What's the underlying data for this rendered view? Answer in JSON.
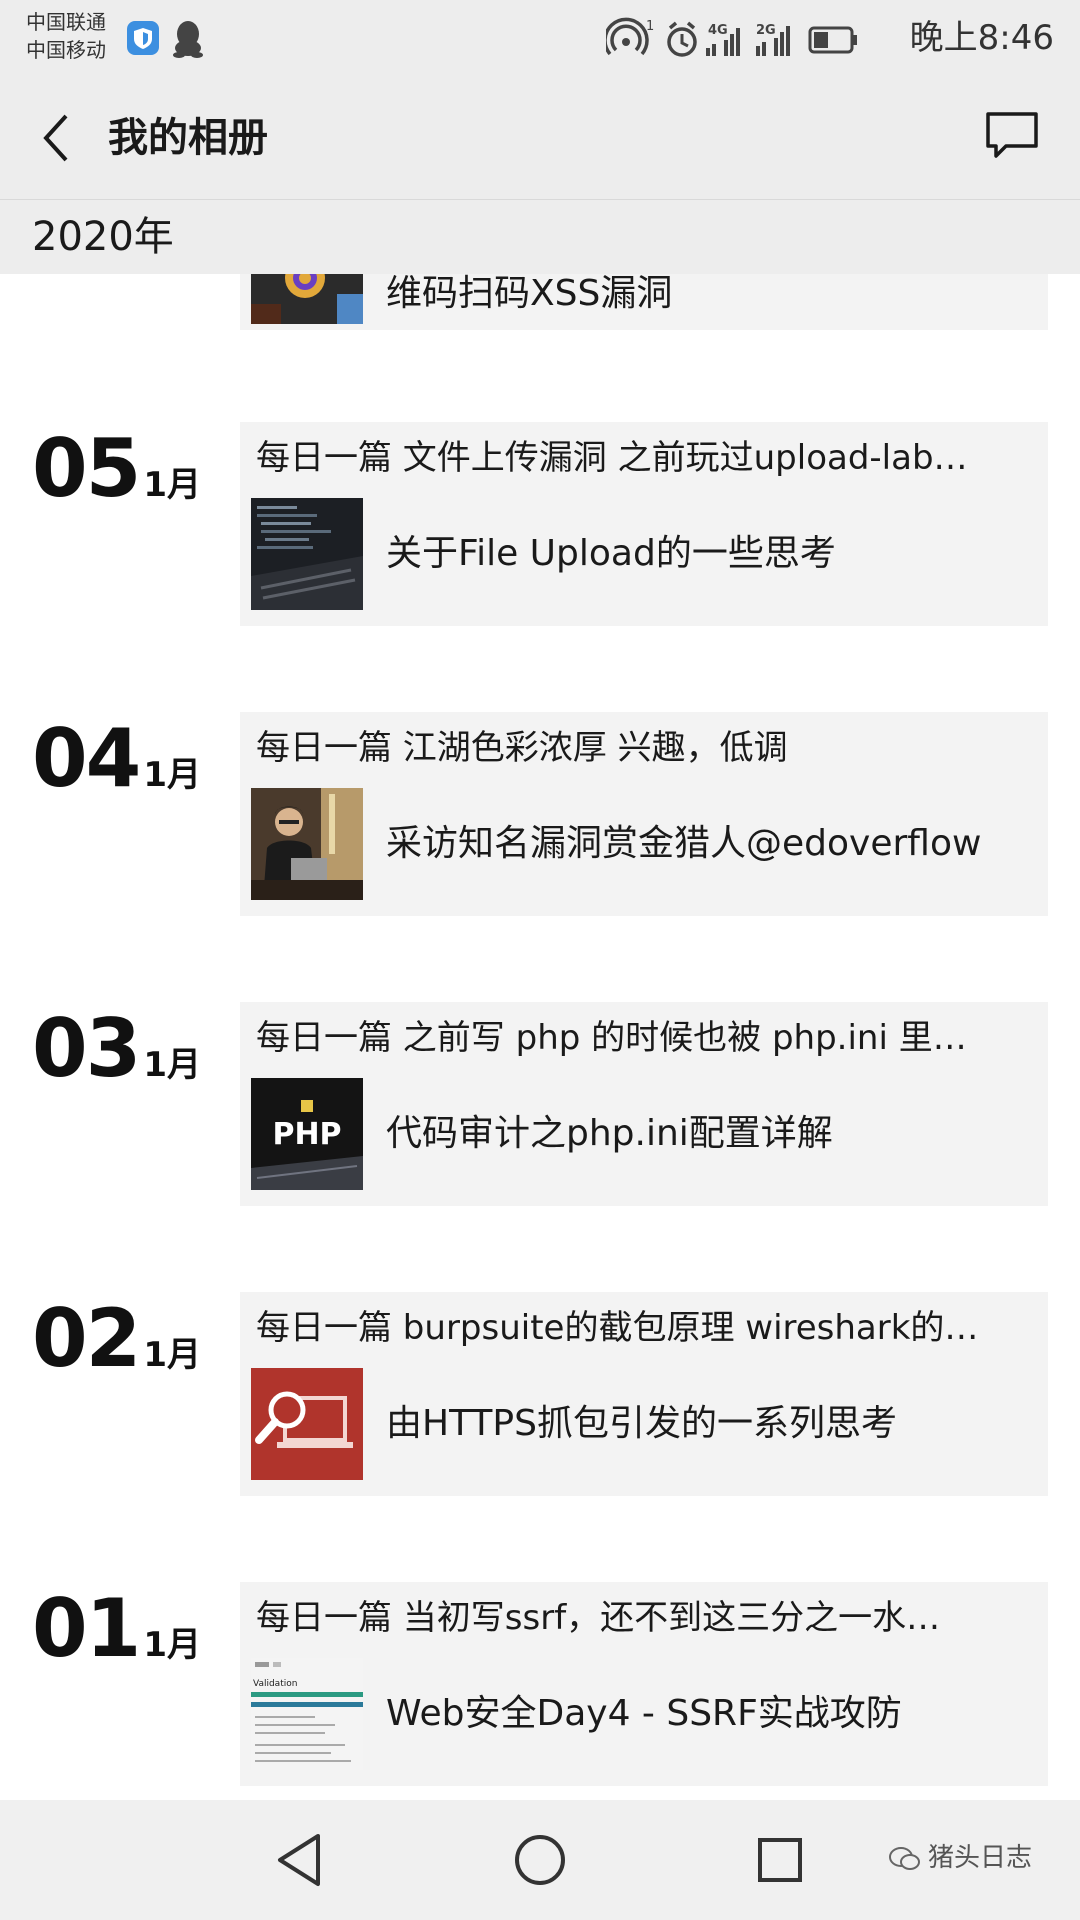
{
  "status_bar": {
    "carrier_1": "中国联通",
    "carrier_2": "中国移动",
    "time": "晚上8:46",
    "network_1": "4G",
    "network_2": "2G",
    "hotspot_count": "1"
  },
  "navbar": {
    "title": "我的相册"
  },
  "year_header": "2020年",
  "top_partial_entry": {
    "article_title": "维码扫码XSS漏洞"
  },
  "entries": [
    {
      "day": "05",
      "month": "1月",
      "caption": "每日一篇 文件上传漏洞 之前玩过upload-lab…",
      "article_title": "关于File Upload的一些思考"
    },
    {
      "day": "04",
      "month": "1月",
      "caption": "每日一篇 江湖色彩浓厚 兴趣，低调",
      "article_title": "采访知名漏洞赏金猎人@edoverflow"
    },
    {
      "day": "03",
      "month": "1月",
      "caption": "每日一篇 之前写 php 的时候也被 php.ini 里…",
      "article_title": "代码审计之php.ini配置详解",
      "thumb_text": "PHP"
    },
    {
      "day": "02",
      "month": "1月",
      "caption": "每日一篇 burpsuite的截包原理 wireshark的…",
      "article_title": "由HTTPS抓包引发的一系列思考"
    },
    {
      "day": "01",
      "month": "1月",
      "caption": "每日一篇 当初写ssrf，还不到这三分之一水…",
      "article_title": "Web安全Day4 - SSRF实战攻防",
      "thumb_text": "Validation"
    }
  ],
  "watermark": "猪头日志"
}
